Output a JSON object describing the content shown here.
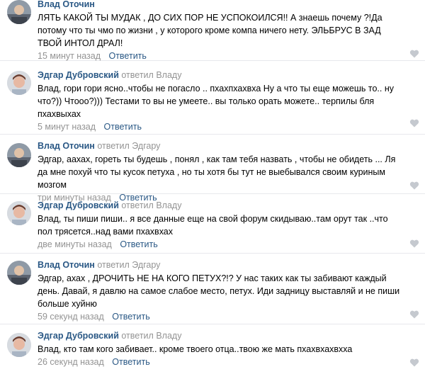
{
  "comments": [
    {
      "author": "Влад Оточин",
      "reply_text": "",
      "reply_to": "",
      "text": "ЛЯТЬ КАКОЙ ТЫ МУДАК , ДО СИХ ПОР НЕ УСПОКОИЛСЯ!! А знаешь почему ?!Да потому что ты чмо по жизни , у которого кроме компа ничего нету. ЭЛЬБРУС В ЗАД ТВОЙ ИНТОЛ ДРАЛ!",
      "time": "15 минут назад",
      "answer": "Ответить"
    },
    {
      "author": "Эдгар Дубровский",
      "reply_text": "ответил",
      "reply_to": "Владу",
      "text": "Влад, гори гори ясно..чтобы не погасло .. пхахпхахвха Ну а что ты еще можешь то.. ну что?)) Чтооо?))) Тестами то вы не умеете.. вы только орать можете.. терпилы бля пхахвыхах",
      "time": "5 минут назад",
      "answer": "Ответить"
    },
    {
      "author": "Влад Оточин",
      "reply_text": "ответил",
      "reply_to": "Эдгару",
      "text": "Эдгар, аахах, гореть ты будешь , понял , как там тебя назвать , чтобы не обидеть ... Ля да мне похуй что ты кусок петуха , но ты хотя бы тут не выебывался своим куриным мозгом",
      "time": "три минуты назад",
      "answer": "Ответить"
    },
    {
      "author": "Эдгар Дубровский",
      "reply_text": "ответил",
      "reply_to": "Владу",
      "text": "Влад, ты пиши пиши.. я все данные еще на свой форум скидываю..там орут так ..что пол трясется..над вами пхахвхах",
      "time": "две минуты назад",
      "answer": "Ответить"
    },
    {
      "author": "Влад Оточин",
      "reply_text": "ответил",
      "reply_to": "Эдгару",
      "text": "Эдгар, ахах , ДРОЧИТЬ НЕ НА КОГО ПЕТУХ?!? У нас таких как ты забивают каждый день. Давай, я давлю на самое слабое место, петух. Иди задницу выставляй и не пиши больше хуйню",
      "time": "59 секунд назад",
      "answer": "Ответить"
    },
    {
      "author": "Эдгар Дубровский",
      "reply_text": "ответил",
      "reply_to": "Владу",
      "text": "Влад, кто там кого забивает.. кроме твоего отца..твою же мать пхахвхахвхха",
      "time": "26 секунд назад",
      "answer": "Ответить"
    }
  ],
  "icons": {
    "like": "heart-icon"
  },
  "colors": {
    "link": "#2a5885",
    "muted": "#939393",
    "divider": "#e7e8ec",
    "like": "#c5c9cf"
  }
}
